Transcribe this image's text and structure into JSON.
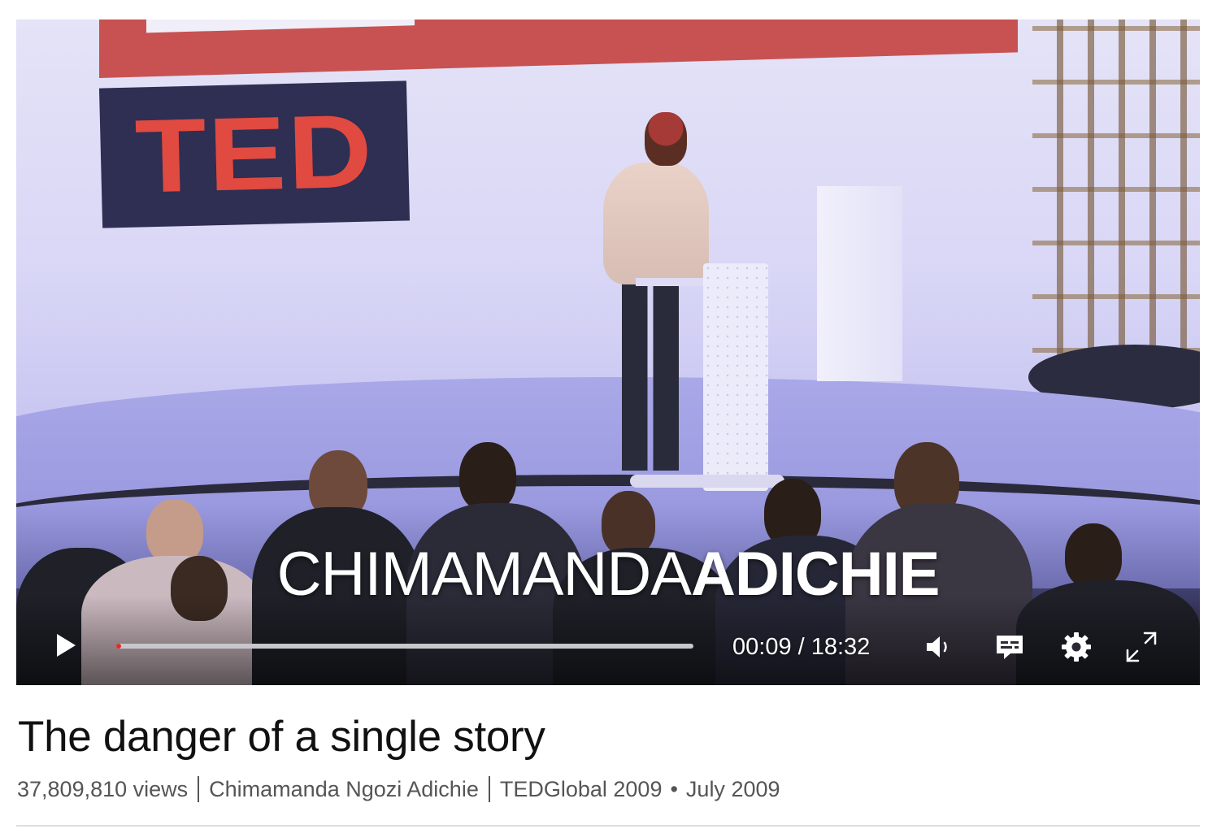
{
  "video": {
    "logo_text": "TED",
    "caption_first": "CHIMAMANDA",
    "caption_last": "ADICHIE",
    "time_current": "00:09",
    "time_total": "18:32",
    "time_display": "00:09 / 18:32",
    "progress_fraction": 0.008,
    "controls": {
      "play_icon": "play-icon",
      "volume_icon": "volume-icon",
      "captions_icon": "captions-icon",
      "settings_icon": "gear-icon",
      "fullscreen_icon": "fullscreen-icon"
    }
  },
  "talk": {
    "title": "The danger of a single story",
    "views": "37,809,810 views",
    "speaker": "Chimamanda Ngozi Adichie",
    "event": "TEDGlobal 2009",
    "date": "July 2009"
  },
  "colors": {
    "accent": "#e62b1e",
    "ted_red": "#e04a41"
  }
}
